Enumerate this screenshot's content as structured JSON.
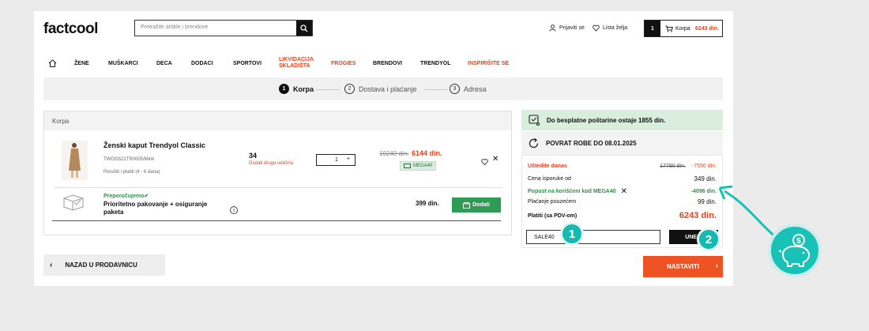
{
  "header": {
    "logo": "factcool",
    "search_placeholder": "Pretražite artikle i brendove",
    "login_label": "Prijaviti se",
    "wishlist_label": "Lista želja",
    "cart_count": "1",
    "cart_label": "Korpa",
    "cart_total": "6243 din."
  },
  "nav": {
    "items": [
      "ŽENE",
      "MUŠKARCI",
      "DECA",
      "DODACI",
      "SPORTOVI",
      "LIKVIDACIJA",
      "SKLADIŠTA",
      "FROGIES",
      "BRENDOVI",
      "TRENDYOL",
      "INSPIRIŠITE SE"
    ]
  },
  "steps": [
    {
      "num": "1",
      "label": "Korpa"
    },
    {
      "num": "2",
      "label": "Dostava i plaćanje"
    },
    {
      "num": "3",
      "label": "Adresa"
    }
  ],
  "cart": {
    "header": "Korpa",
    "product": {
      "title": "Ženski kaput Trendyol Classic",
      "sku": "TWOSS21TR0005/Mink",
      "shipping": "Poručiti i platiti (4 - 6 dana)",
      "size": "34",
      "change_size": "Dodati drugu veličinu",
      "qty": "1",
      "qty_plus": "+",
      "old_price": "10240 din.",
      "new_price": "6144 din.",
      "badge": "MEGA40"
    },
    "packaging": {
      "recommended": "Preporučujemo",
      "title": "Prioritetno pakovanje + osiguranje paketa",
      "price": "399 din.",
      "add_label": "Dodati"
    }
  },
  "back_label": "NAZAD U PRODAVNICU",
  "sidebar": {
    "free_shipping": "Do besplatne poštarine ostaje 1855 din.",
    "return_text": "POVRAT ROBE DO 08.01.2025",
    "savings_label": "Uštedite danas",
    "savings_old": "17790 din.",
    "savings_value": "-7550 din.",
    "delivery_label": "Cena isporuke od",
    "delivery_value": "349 din.",
    "discount_label": "Popust na korišćeni kod MEGA40",
    "discount_value": "-4096 din.",
    "cod_label": "Plaćanje pouzećem",
    "cod_value": "99 din.",
    "total_label": "Platiti (sa PDV-om)",
    "total_value": "6243 din.",
    "coupon_value": "SALE40",
    "apply_label": "UNESI",
    "next_label": "NASTAVITI"
  },
  "callouts": [
    "1",
    "2"
  ],
  "colors": {
    "accent": "#e4411d",
    "green": "#2f9b54",
    "teal": "#19c2b7"
  }
}
